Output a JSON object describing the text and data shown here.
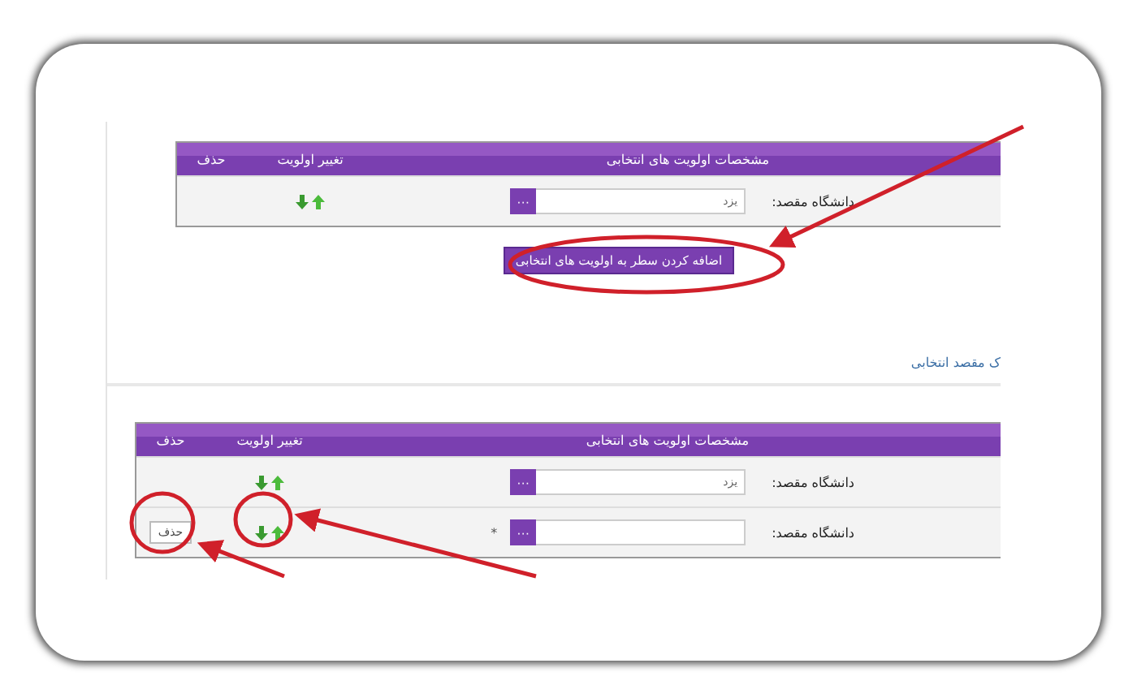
{
  "top_table": {
    "columns": [
      "مشخصات اولویت های انتخابی",
      "تغییر اولویت",
      "حذف"
    ],
    "rows": [
      {
        "label": "دانشگاه مقصد:",
        "value": "یزد",
        "picker": "···"
      }
    ]
  },
  "add_row_button": "اضافه کردن سطر به اولویت های انتخابی",
  "section_title": "ک مقصد انتخابی",
  "bottom_table": {
    "columns": [
      "مشخصات اولویت های انتخابی",
      "تغییر اولویت",
      "حذف"
    ],
    "rows": [
      {
        "label": "دانشگاه مقصد:",
        "value": "یزد",
        "picker": "···"
      },
      {
        "label": "دانشگاه مقصد:",
        "picker": "···",
        "required_mark": "*",
        "delete_button": "حذف"
      }
    ]
  }
}
